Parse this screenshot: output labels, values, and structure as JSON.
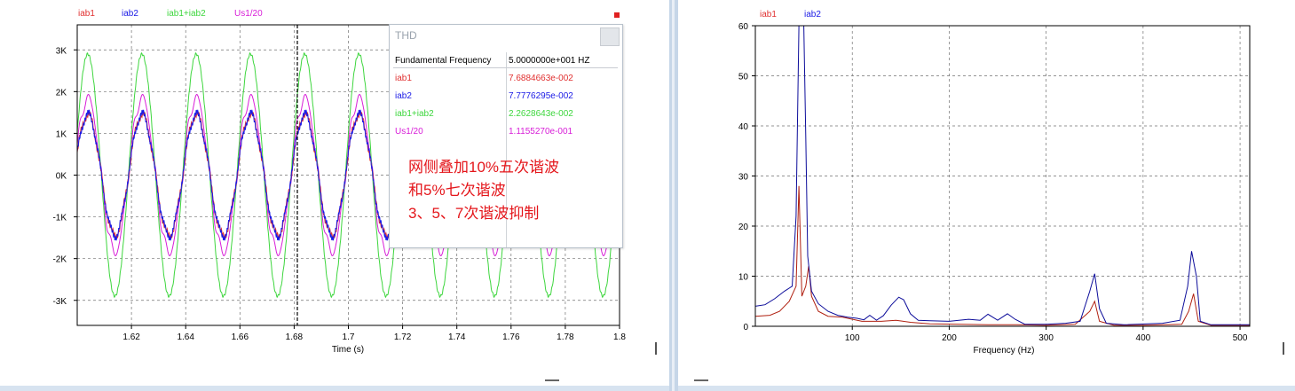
{
  "colors": {
    "iab1": "#e03030",
    "iab2": "#1a1ae6",
    "sum": "#3ed63e",
    "us": "#d81ed8",
    "thd_title": "#9aa3ad",
    "annotation": "#e4161b"
  },
  "left_legend": {
    "iab1": "iab1",
    "iab2": "iab2",
    "sum": "iab1+iab2",
    "us": "Us1/20"
  },
  "right_legend": {
    "iab1": "iab1",
    "iab2": "iab2"
  },
  "thd": {
    "title": "THD",
    "header_label": "Fundamental Frequency",
    "header_value": "5.0000000e+001 HZ",
    "rows": [
      {
        "label": "iab1",
        "value": "7.6884663e-002"
      },
      {
        "label": "iab2",
        "value": "7.7776295e-002"
      },
      {
        "label": "iab1+iab2",
        "value": "2.2628643e-002"
      },
      {
        "label": "Us1/20",
        "value": "1.1155270e-001"
      }
    ]
  },
  "annotation": "网侧叠加10%五次谐波\n和5%七次谐波\n3、5、7次谐波抑制",
  "chart_data": [
    {
      "type": "line",
      "xlabel": "Time (s)",
      "xlim": [
        1.6,
        1.8
      ],
      "ylim": [
        -3.6,
        3.6
      ],
      "x_ticks": [
        "1.62",
        "1.64",
        "1.66",
        "1.68",
        "1.7",
        "1.72",
        "1.74",
        "1.76",
        "1.78",
        "1.8"
      ],
      "y_ticks": [
        "3K",
        "2K",
        "1K",
        "0K",
        "-1K",
        "-2K",
        "-3K"
      ],
      "frequency_hz": 50,
      "series": [
        {
          "name": "iab1",
          "amplitude_k": 1.45
        },
        {
          "name": "iab2",
          "amplitude_k": 1.45
        },
        {
          "name": "iab1+iab2",
          "amplitude_k": 2.9
        },
        {
          "name": "Us1/20",
          "amplitude_k": 1.85
        }
      ],
      "grid": true
    },
    {
      "type": "line",
      "xlabel": "Frequency (Hz)",
      "xlim": [
        0,
        510
      ],
      "ylim": [
        0,
        60
      ],
      "x_ticks": [
        "100",
        "200",
        "300",
        "400",
        "500"
      ],
      "y_ticks": [
        "60",
        "50",
        "40",
        "30",
        "20",
        "10",
        "0"
      ],
      "series": [
        {
          "name": "iab1",
          "points": [
            [
              0,
              2
            ],
            [
              15,
              2.2
            ],
            [
              25,
              3
            ],
            [
              35,
              5
            ],
            [
              42,
              8
            ],
            [
              45,
              28
            ],
            [
              48,
              6
            ],
            [
              52,
              8
            ],
            [
              55,
              12
            ],
            [
              58,
              6
            ],
            [
              65,
              3
            ],
            [
              75,
              2
            ],
            [
              90,
              1.8
            ],
            [
              110,
              1
            ],
            [
              130,
              1
            ],
            [
              145,
              1.2
            ],
            [
              160,
              0.8
            ],
            [
              180,
              0.5
            ],
            [
              210,
              0.4
            ],
            [
              240,
              0.3
            ],
            [
              270,
              0.3
            ],
            [
              300,
              0.2
            ],
            [
              330,
              0.4
            ],
            [
              345,
              3
            ],
            [
              350,
              5
            ],
            [
              355,
              1
            ],
            [
              370,
              0.2
            ],
            [
              400,
              0.2
            ],
            [
              440,
              0.4
            ],
            [
              447,
              3
            ],
            [
              452,
              6.5
            ],
            [
              457,
              1
            ],
            [
              470,
              0.2
            ],
            [
              510,
              0.2
            ]
          ]
        },
        {
          "name": "iab2",
          "points": [
            [
              0,
              4
            ],
            [
              10,
              4.3
            ],
            [
              20,
              5.5
            ],
            [
              30,
              7
            ],
            [
              38,
              8
            ],
            [
              42,
              22
            ],
            [
              45,
              60
            ],
            [
              48,
              60
            ],
            [
              50,
              60
            ],
            [
              52,
              38
            ],
            [
              54,
              14
            ],
            [
              58,
              7
            ],
            [
              65,
              4.5
            ],
            [
              75,
              3
            ],
            [
              85,
              2.2
            ],
            [
              95,
              1.8
            ],
            [
              105,
              1.6
            ],
            [
              112,
              1.3
            ],
            [
              118,
              2.2
            ],
            [
              125,
              1.2
            ],
            [
              132,
              2.1
            ],
            [
              140,
              4.2
            ],
            [
              148,
              5.8
            ],
            [
              153,
              5.3
            ],
            [
              160,
              2.5
            ],
            [
              168,
              1.2
            ],
            [
              180,
              1.1
            ],
            [
              200,
              1
            ],
            [
              220,
              1.4
            ],
            [
              232,
              1.2
            ],
            [
              240,
              2.4
            ],
            [
              250,
              1.2
            ],
            [
              260,
              2.5
            ],
            [
              268,
              1.4
            ],
            [
              278,
              0.4
            ],
            [
              300,
              0.4
            ],
            [
              320,
              0.6
            ],
            [
              335,
              1
            ],
            [
              345,
              7
            ],
            [
              350,
              10.5
            ],
            [
              355,
              3.5
            ],
            [
              362,
              0.6
            ],
            [
              380,
              0.3
            ],
            [
              420,
              0.6
            ],
            [
              438,
              1.2
            ],
            [
              446,
              8
            ],
            [
              450,
              15
            ],
            [
              455,
              10
            ],
            [
              459,
              1
            ],
            [
              470,
              0.3
            ],
            [
              510,
              0.3
            ]
          ]
        }
      ],
      "grid": true
    }
  ]
}
